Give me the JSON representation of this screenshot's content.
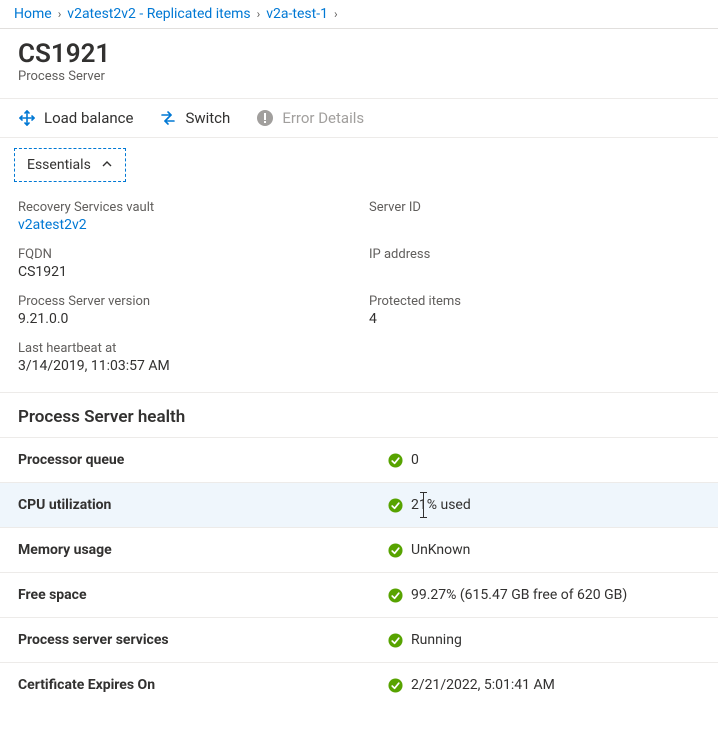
{
  "breadcrumb": {
    "items": [
      {
        "label": "Home"
      },
      {
        "label": "v2atest2v2 - Replicated items"
      },
      {
        "label": "v2a-test-1"
      }
    ]
  },
  "header": {
    "title": "CS1921",
    "subtitle": "Process Server"
  },
  "toolbar": {
    "load_balance": "Load balance",
    "switch": "Switch",
    "error_details": "Error Details"
  },
  "essentials_toggle": "Essentials",
  "essentials": {
    "left": [
      {
        "label": "Recovery Services vault",
        "value": "v2atest2v2",
        "link": true
      },
      {
        "label": "FQDN",
        "value": "CS1921"
      },
      {
        "label": "Process Server version",
        "value": "9.21.0.0"
      },
      {
        "label": "Last heartbeat at",
        "value": "3/14/2019, 11:03:57 AM"
      }
    ],
    "right": [
      {
        "label": "Server ID",
        "value": ""
      },
      {
        "label": "IP address",
        "value": ""
      },
      {
        "label": "Protected items",
        "value": "4"
      }
    ]
  },
  "health": {
    "heading": "Process Server health",
    "rows": [
      {
        "label": "Processor queue",
        "value": "0",
        "status": "ok"
      },
      {
        "label": "CPU utilization",
        "value": "21% used",
        "status": "ok",
        "highlight": true,
        "caret_index": 1
      },
      {
        "label": "Memory usage",
        "value": "UnKnown",
        "status": "ok"
      },
      {
        "label": "Free space",
        "value": "99.27% (615.47 GB free of 620 GB)",
        "status": "ok"
      },
      {
        "label": "Process server services",
        "value": "Running",
        "status": "ok"
      },
      {
        "label": "Certificate Expires On",
        "value": "2/21/2022, 5:01:41 AM",
        "status": "ok"
      }
    ]
  }
}
